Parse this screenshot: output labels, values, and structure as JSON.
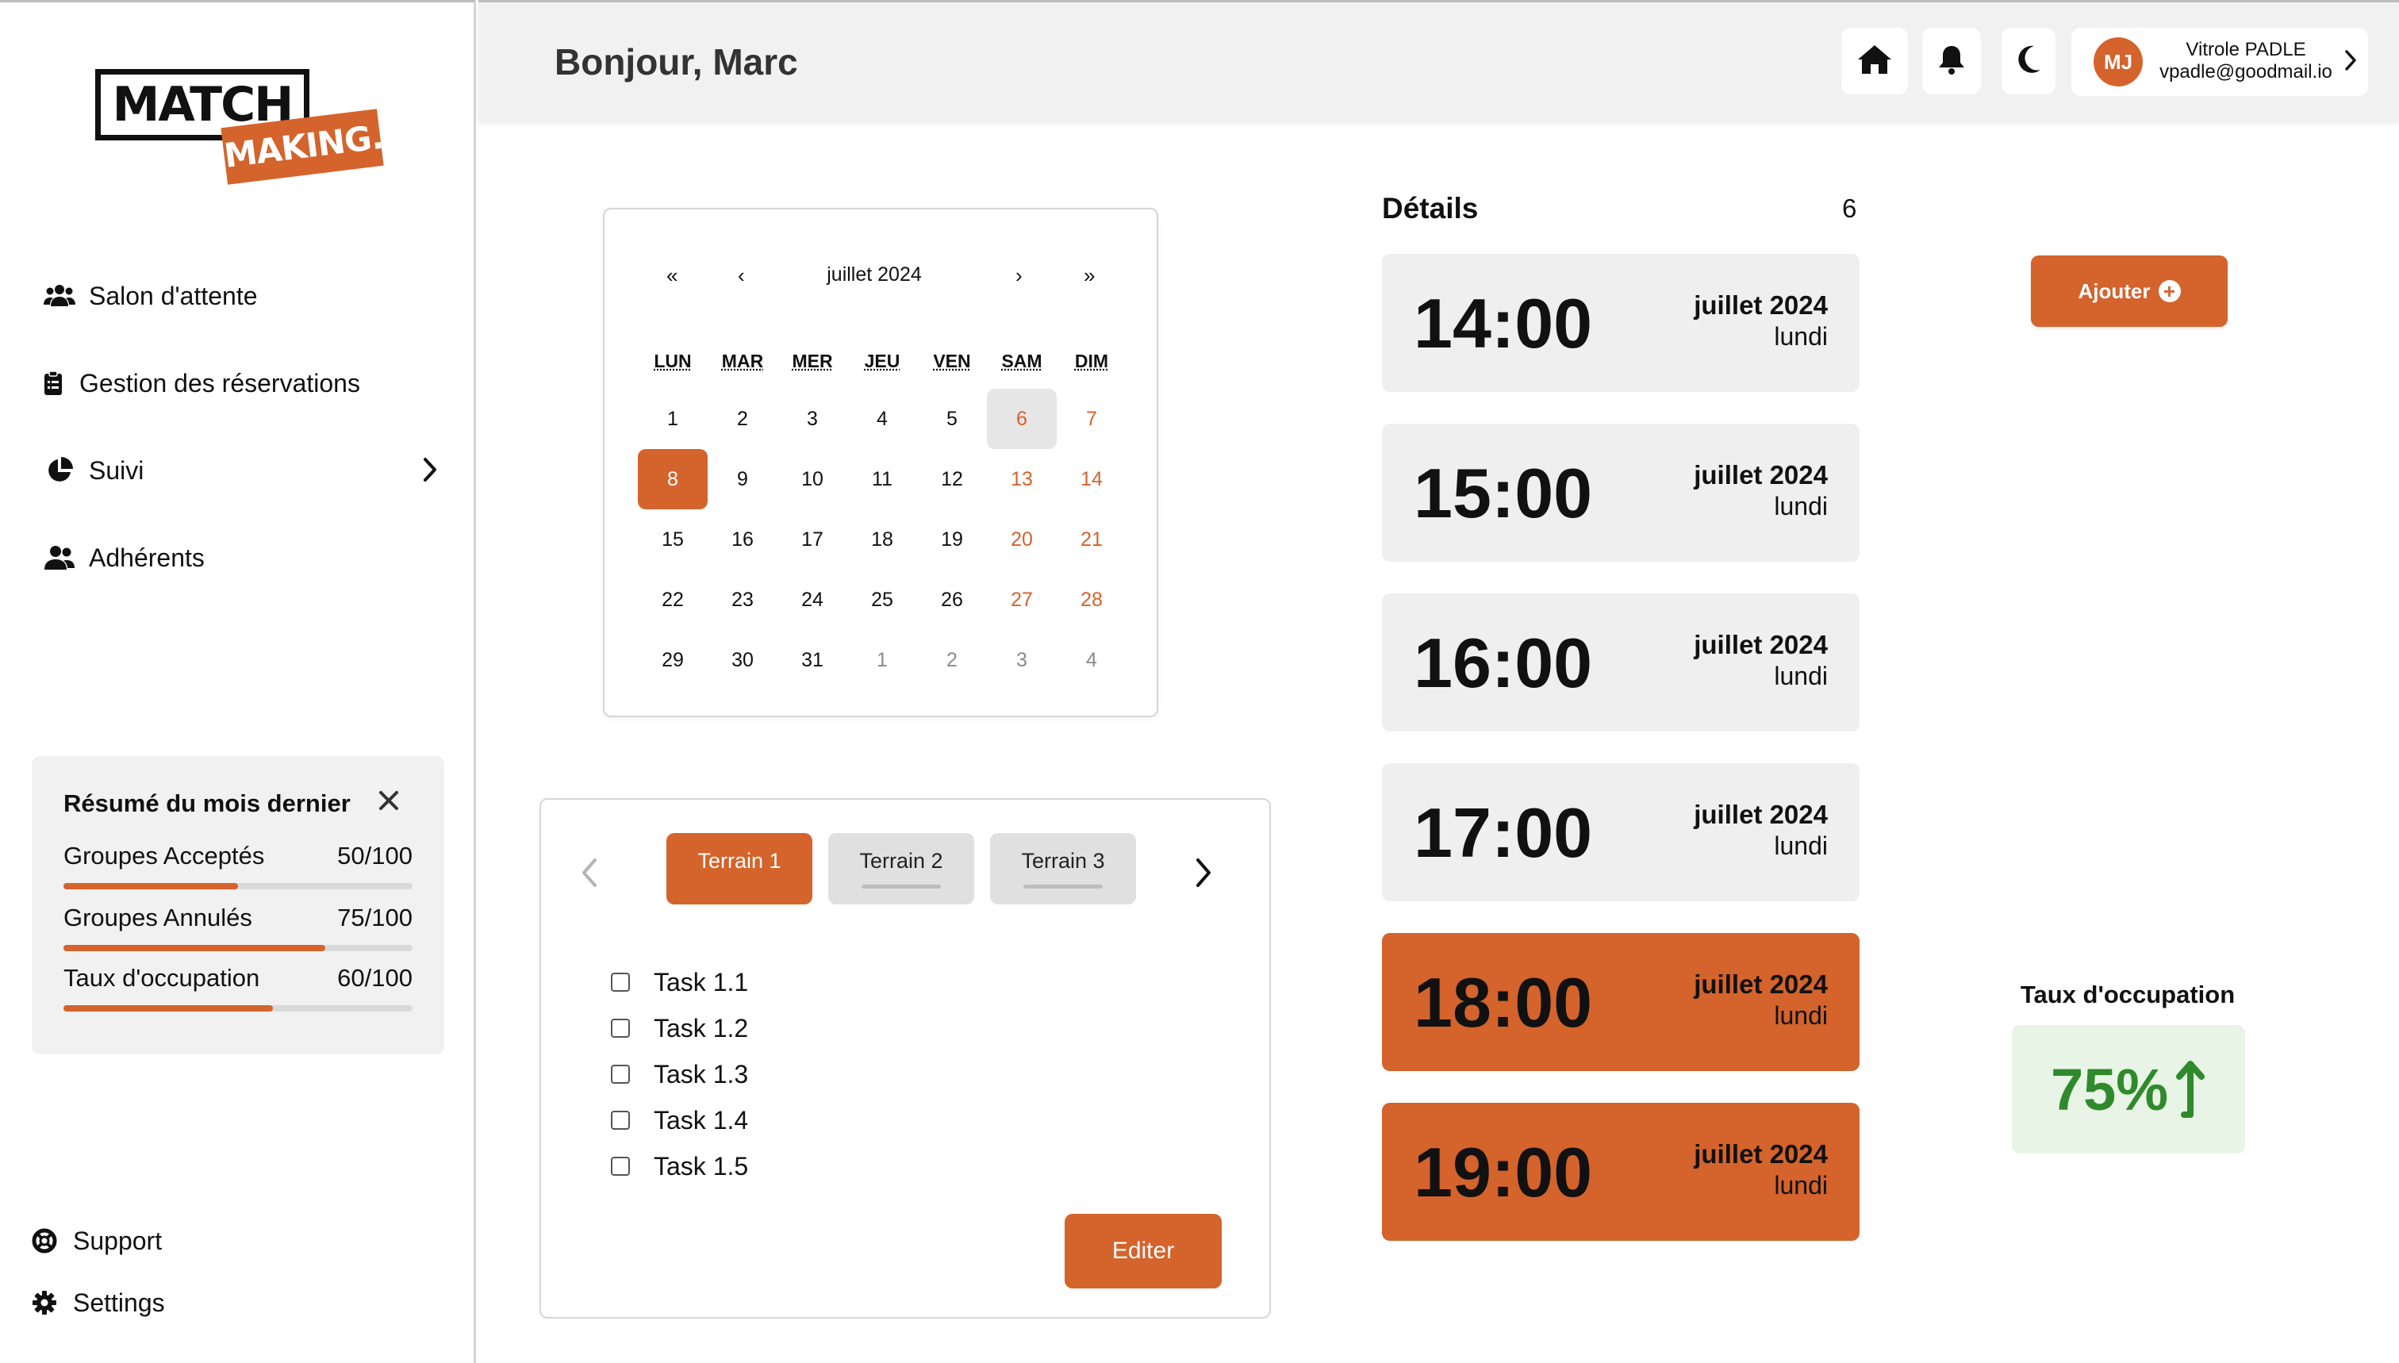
{
  "brand": {
    "line1": "MATCH",
    "line2": "MAKING.",
    "accent": "#d4632c"
  },
  "sidebar": {
    "items": [
      {
        "label": "Salon d'attente",
        "icon": "users-icon"
      },
      {
        "label": "Gestion des réservations",
        "icon": "clipboard-icon"
      },
      {
        "label": "Suivi",
        "icon": "pie-chart-icon",
        "has_submenu": true
      },
      {
        "label": "Adhérents",
        "icon": "user-group-icon"
      }
    ],
    "summary": {
      "title": "Résumé du mois dernier",
      "rows": [
        {
          "label": "Groupes Acceptés",
          "value": "50/100",
          "fraction": 0.5
        },
        {
          "label": "Groupes Annulés",
          "value": "75/100",
          "fraction": 0.75
        },
        {
          "label": "Taux d'occupation",
          "value": "60/100",
          "fraction": 0.6
        }
      ]
    },
    "footer": [
      {
        "label": "Support",
        "icon": "lifebuoy-icon"
      },
      {
        "label": "Settings",
        "icon": "gear-icon"
      }
    ]
  },
  "header": {
    "greeting": "Bonjour, Marc",
    "user": {
      "initials": "MJ",
      "name": "Vitrole PADLE",
      "email": "vpadle@goodmail.io"
    }
  },
  "calendar": {
    "nav": {
      "prev_year": "«",
      "prev_month": "‹",
      "next_month": "›",
      "next_year": "»"
    },
    "month_label": "juillet 2024",
    "weekdays": [
      "LUN",
      "MAR",
      "MER",
      "JEU",
      "VEN",
      "SAM",
      "DIM"
    ],
    "weeks": [
      [
        "1",
        "2",
        "3",
        "4",
        "5",
        "6",
        "7"
      ],
      [
        "8",
        "9",
        "10",
        "11",
        "12",
        "13",
        "14"
      ],
      [
        "15",
        "16",
        "17",
        "18",
        "19",
        "20",
        "21"
      ],
      [
        "22",
        "23",
        "24",
        "25",
        "26",
        "27",
        "28"
      ],
      [
        "29",
        "30",
        "31",
        "1",
        "2",
        "3",
        "4"
      ]
    ],
    "selected_day": "8",
    "today_day": "6",
    "next_month_days_in_last_week": 4
  },
  "tasks": {
    "tabs": [
      "Terrain 1",
      "Terrain 2",
      "Terrain 3"
    ],
    "active_tab": 0,
    "items": [
      "Task 1.1",
      "Task 1.2",
      "Task 1.3",
      "Task 1.4",
      "Task 1.5"
    ],
    "edit_label": "Editer"
  },
  "details": {
    "title": "Détails",
    "count": "6",
    "slots": [
      {
        "time": "14:00",
        "month": "juillet 2024",
        "day": "lundi",
        "booked": false
      },
      {
        "time": "15:00",
        "month": "juillet 2024",
        "day": "lundi",
        "booked": false
      },
      {
        "time": "16:00",
        "month": "juillet 2024",
        "day": "lundi",
        "booked": false
      },
      {
        "time": "17:00",
        "month": "juillet 2024",
        "day": "lundi",
        "booked": false
      },
      {
        "time": "18:00",
        "month": "juillet 2024",
        "day": "lundi",
        "booked": true
      },
      {
        "time": "19:00",
        "month": "juillet 2024",
        "day": "lundi",
        "booked": true
      }
    ]
  },
  "add_button": {
    "label": "Ajouter",
    "icon": "plus-circle-icon"
  },
  "occupancy": {
    "title": "Taux d'occupation",
    "value": "75%",
    "trend_icon": "arrow-up-icon",
    "color": "#2f8a2b"
  }
}
